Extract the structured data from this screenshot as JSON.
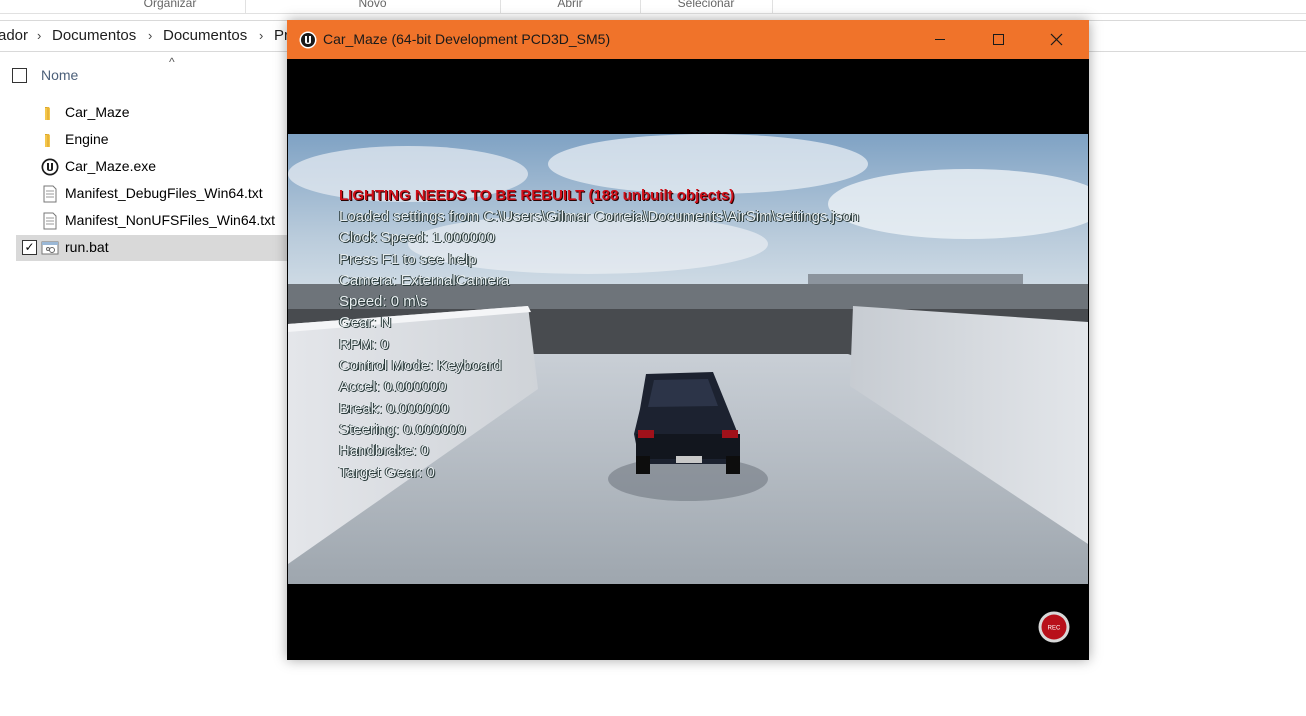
{
  "explorer": {
    "ribbon_groups": [
      "Organizar",
      "Novo",
      "Abrir",
      "Selecionar"
    ],
    "breadcrumbs": [
      "ador",
      "Documentos",
      "Documentos",
      "Pr"
    ],
    "column_header": "Nome",
    "files": [
      {
        "name": "Car_Maze",
        "icon": "folder-icon",
        "selected": false
      },
      {
        "name": "Engine",
        "icon": "folder-icon",
        "selected": false
      },
      {
        "name": "Car_Maze.exe",
        "icon": "unreal-app-icon",
        "selected": false
      },
      {
        "name": "Manifest_DebugFiles_Win64.txt",
        "icon": "text-file-icon",
        "selected": false
      },
      {
        "name": "Manifest_NonUFSFiles_Win64.txt",
        "icon": "text-file-icon",
        "selected": false
      },
      {
        "name": "run.bat",
        "icon": "batch-file-icon",
        "selected": true
      }
    ]
  },
  "game_window": {
    "title": "Car_Maze (64-bit Development PCD3D_SM5)",
    "titlebar_color": "#f0732a",
    "controls": [
      "minimize-icon",
      "maximize-icon",
      "close-icon"
    ],
    "hud": {
      "warning": "LIGHTING NEEDS TO BE REBUILT (188 unbuilt objects)",
      "lines": [
        "Loaded settings from C:\\Users\\Gilmar Correia\\Documents\\AirSim\\settings.json",
        "Clock Speed: 1.000000",
        "Press F1 to see help",
        "Camera: ExternalCamera",
        "Speed: 0 m\\s",
        "Gear: N",
        "RPM: 0",
        "Control Mode: Keyboard",
        "Accel: 0.000000",
        "Break: 0.000000",
        "Steering: 0.000000",
        "Handbrake: 0",
        "Target Gear: 0"
      ]
    },
    "record_button_label": "REC"
  }
}
